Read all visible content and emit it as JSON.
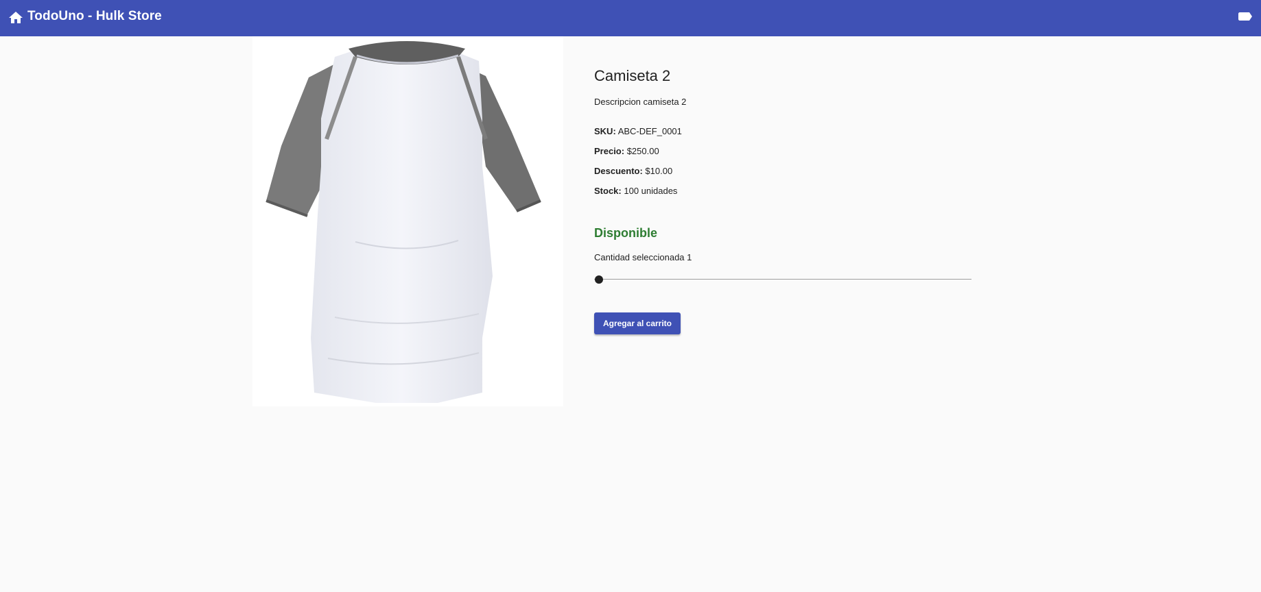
{
  "header": {
    "title": "TodoUno - Hulk Store",
    "home_icon": "home-icon",
    "cart_icon": "label-icon",
    "background_color": "#3f51b5"
  },
  "product": {
    "image_icon": "t-shirt-photo",
    "title": "Camiseta 2",
    "description": "Descripcion camiseta 2",
    "sku_label": "SKU:",
    "sku_value": "ABC-DEF_0001",
    "price_label": "Precio:",
    "price_value": "$250.00",
    "discount_label": "Descuento:",
    "discount_value": "$10.00",
    "stock_label": "Stock:",
    "stock_value": "100 unidades",
    "availability": "Disponible",
    "availability_color": "#2e7d32"
  },
  "quantity": {
    "label": "Cantidad seleccionada 1",
    "value": 1,
    "min": 1,
    "max": 100
  },
  "actions": {
    "add_to_cart_label": "Agregar al carrito"
  }
}
